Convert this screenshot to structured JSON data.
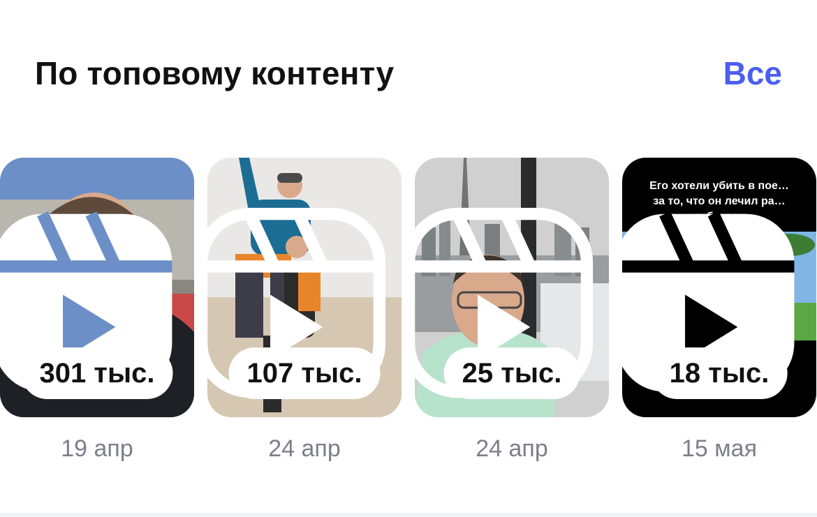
{
  "section": {
    "title": "По топовому контенту",
    "see_all": "Все"
  },
  "cards": [
    {
      "views": "301 тыс.",
      "date": "19 апр",
      "icon": "reels-icon"
    },
    {
      "views": "107 тыс.",
      "date": "24 апр",
      "icon": "reels-icon"
    },
    {
      "views": "25 тыс.",
      "date": "24 апр",
      "icon": "reels-icon"
    },
    {
      "views": "18 тыс.",
      "date": "15 мая",
      "icon": "reels-icon",
      "overlay_text": [
        "Его хотели убить в пое…",
        "за то, что он лечил ра…",
        "таблеток"
      ]
    }
  ]
}
